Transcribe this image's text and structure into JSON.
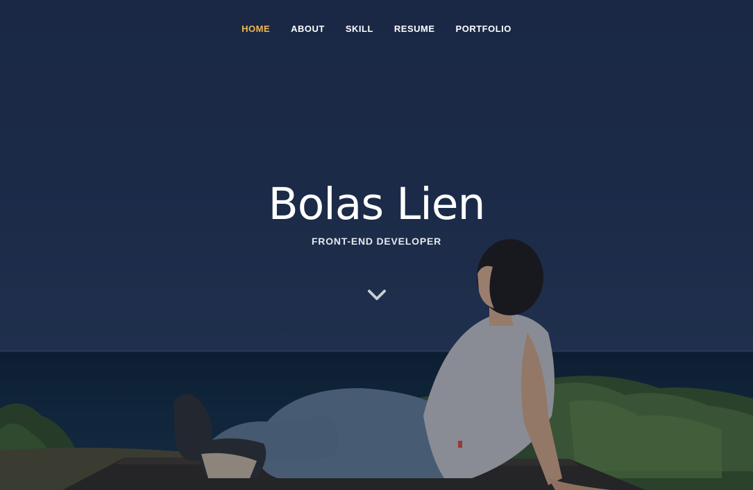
{
  "nav": {
    "items": [
      {
        "label": "HOME",
        "active": true
      },
      {
        "label": "ABOUT",
        "active": false
      },
      {
        "label": "SKILL",
        "active": false
      },
      {
        "label": "RESUME",
        "active": false
      },
      {
        "label": "PORTFOLIO",
        "active": false
      }
    ],
    "active_color": "#f2b94a"
  },
  "hero": {
    "name": "Bolas Lien",
    "role": "FRONT-END DEVELOPER"
  },
  "icons": {
    "scroll": "chevron-down-icon"
  }
}
